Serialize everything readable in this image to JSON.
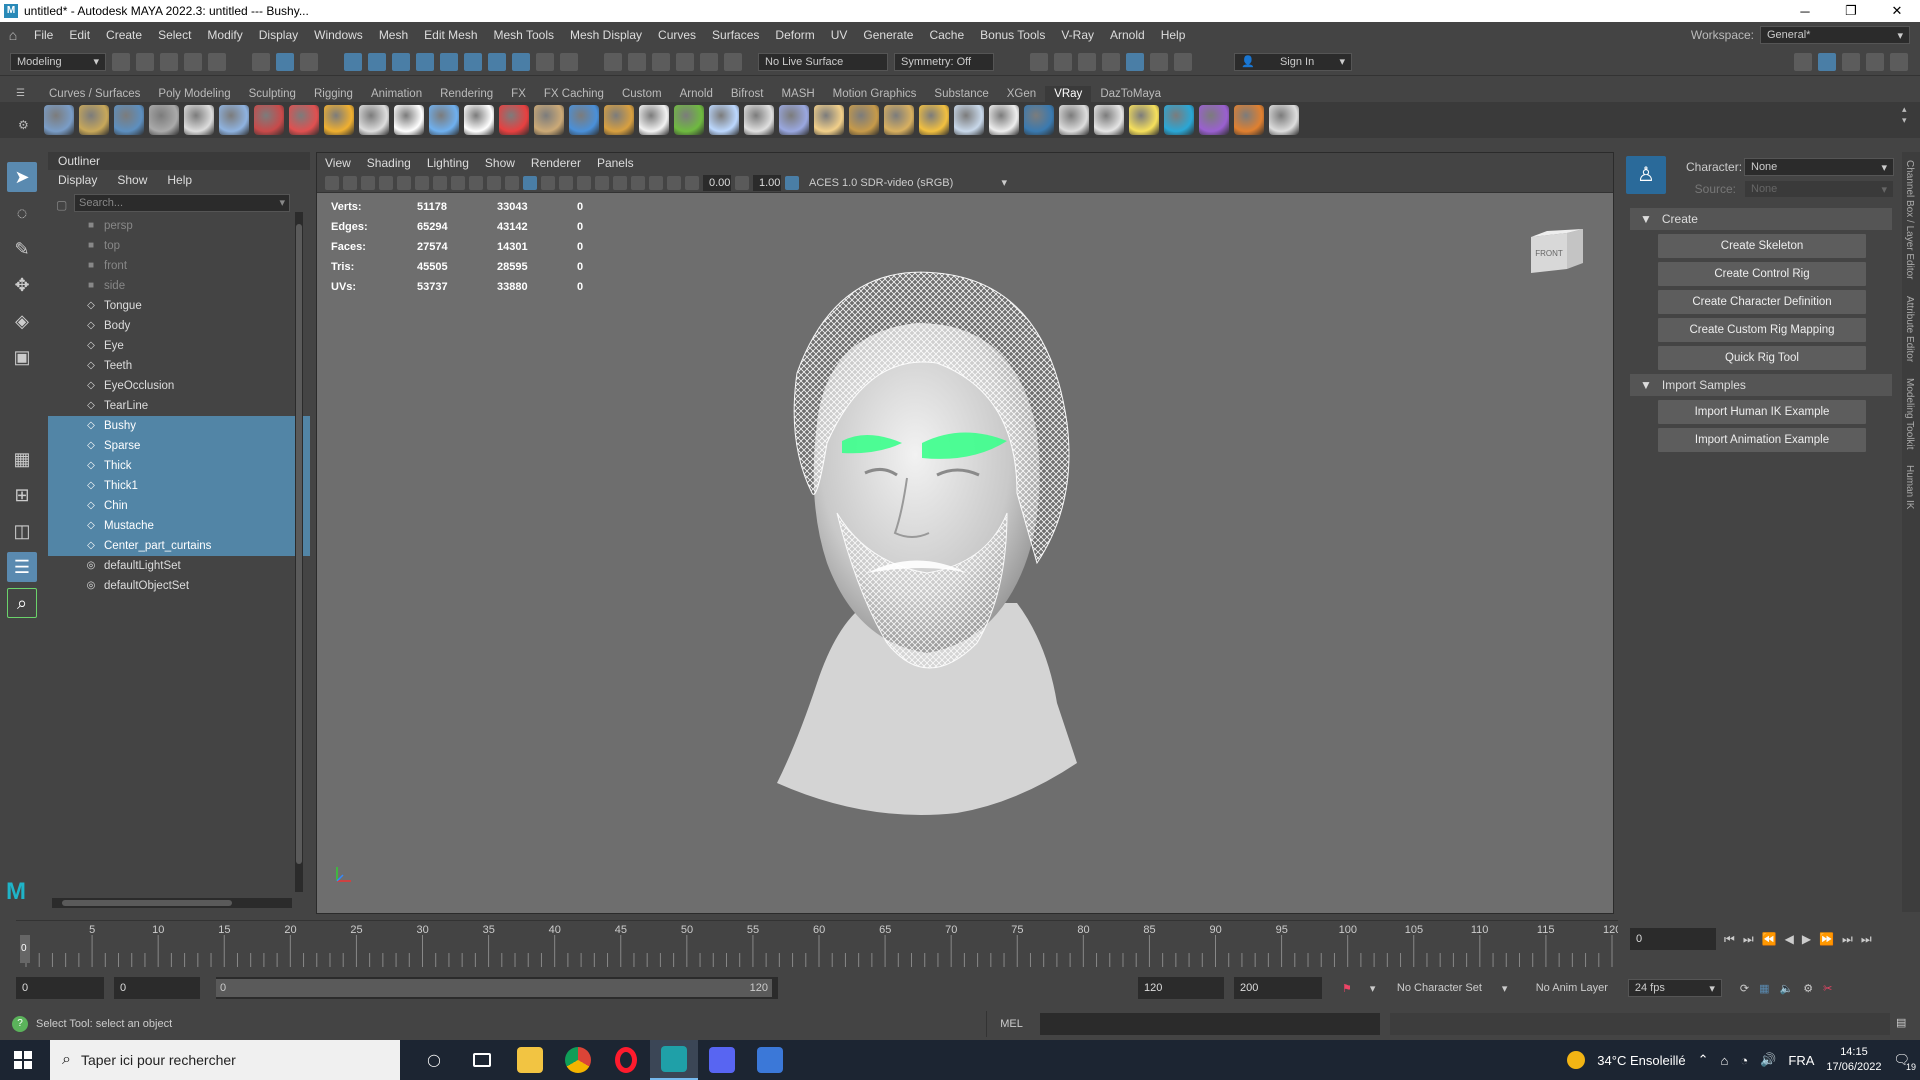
{
  "window": {
    "title": "untitled* - Autodesk MAYA 2022.3: untitled  ---  Bushy...",
    "minimize": "─",
    "maximize": "❐",
    "close": "✕"
  },
  "menubar": {
    "items": [
      "File",
      "Edit",
      "Create",
      "Select",
      "Modify",
      "Display",
      "Windows",
      "Mesh",
      "Edit Mesh",
      "Mesh Tools",
      "Mesh Display",
      "Curves",
      "Surfaces",
      "Deform",
      "UV",
      "Generate",
      "Cache",
      "Bonus Tools",
      "V-Ray",
      "Arnold",
      "Help"
    ],
    "workspace_label": "Workspace:",
    "workspace_value": "General*"
  },
  "statusline": {
    "mode": "Modeling",
    "live_surface": "No Live Surface",
    "symmetry": "Symmetry: Off",
    "sign_in": "Sign In"
  },
  "shelf": {
    "tabs": [
      "Curves / Surfaces",
      "Poly Modeling",
      "Sculpting",
      "Rigging",
      "Animation",
      "Rendering",
      "FX",
      "FX Caching",
      "Custom",
      "Arnold",
      "Bifrost",
      "MASH",
      "Motion Graphics",
      "Substance",
      "XGen",
      "VRay",
      "DazToMaya"
    ],
    "active_tab": "VRay",
    "icon_colors": [
      "#7a9dc7",
      "#c8a85a",
      "#5d8fbf",
      "#aaaaaa",
      "#dddddd",
      "#8fb3e0",
      "#c84a4a",
      "#e05050",
      "#f0b030",
      "#dddddd",
      "#ffffff",
      "#6fb0ef",
      "#ffffff",
      "#e84040",
      "#ccaa77",
      "#4a90d9",
      "#d8a040",
      "#f2f2f2",
      "#6fba40",
      "#bcd8ff",
      "#e0e0e0",
      "#9aa8e0",
      "#f2d08a",
      "#c69a4a",
      "#d8b060",
      "#f2c040",
      "#c8d8ea",
      "#eeeeee",
      "#3a7ab0",
      "#dddddd",
      "#e5e5e5",
      "#f6e05c",
      "#2aa7d6",
      "#9a60d0",
      "#e08030",
      "#dddddd"
    ]
  },
  "toolbox": {
    "tools": [
      "select-tool",
      "lasso-tool",
      "paint-select-tool",
      "move-tool",
      "rotate-tool",
      "scale-tool"
    ]
  },
  "outliner": {
    "title": "Outliner",
    "menu": [
      "Display",
      "Show",
      "Help"
    ],
    "search_placeholder": "Search...",
    "items": [
      {
        "label": "persp",
        "kind": "camera",
        "selected": false
      },
      {
        "label": "top",
        "kind": "camera",
        "selected": false
      },
      {
        "label": "front",
        "kind": "camera",
        "selected": false
      },
      {
        "label": "side",
        "kind": "camera",
        "selected": false
      },
      {
        "label": "Tongue",
        "kind": "mesh",
        "selected": false
      },
      {
        "label": "Body",
        "kind": "mesh",
        "selected": false
      },
      {
        "label": "Eye",
        "kind": "mesh",
        "selected": false
      },
      {
        "label": "Teeth",
        "kind": "mesh",
        "selected": false
      },
      {
        "label": "EyeOcclusion",
        "kind": "mesh",
        "selected": false
      },
      {
        "label": "TearLine",
        "kind": "mesh",
        "selected": false
      },
      {
        "label": "Bushy",
        "kind": "mesh",
        "selected": true
      },
      {
        "label": "Sparse",
        "kind": "mesh",
        "selected": true
      },
      {
        "label": "Thick",
        "kind": "mesh",
        "selected": true
      },
      {
        "label": "Thick1",
        "kind": "mesh",
        "selected": true
      },
      {
        "label": "Chin",
        "kind": "mesh",
        "selected": true
      },
      {
        "label": "Mustache",
        "kind": "mesh",
        "selected": true
      },
      {
        "label": "Center_part_curtains",
        "kind": "mesh",
        "selected": true
      },
      {
        "label": "defaultLightSet",
        "kind": "set",
        "selected": false
      },
      {
        "label": "defaultObjectSet",
        "kind": "set",
        "selected": false
      }
    ]
  },
  "viewport": {
    "menu": [
      "View",
      "Shading",
      "Lighting",
      "Show",
      "Renderer",
      "Panels"
    ],
    "exposure": "0.00",
    "gamma": "1.00",
    "color_space": "ACES 1.0 SDR-video (sRGB)",
    "hud": [
      {
        "label": "Verts:",
        "a": "51178",
        "b": "33043",
        "c": "0"
      },
      {
        "label": "Edges:",
        "a": "65294",
        "b": "43142",
        "c": "0"
      },
      {
        "label": "Faces:",
        "a": "27574",
        "b": "14301",
        "c": "0"
      },
      {
        "label": "Tris:",
        "a": "45505",
        "b": "28595",
        "c": "0"
      },
      {
        "label": "UVs:",
        "a": "53737",
        "b": "33880",
        "c": "0"
      }
    ],
    "viewcube_label": "FRONT"
  },
  "humanik": {
    "character_label": "Character:",
    "character_value": "None",
    "source_label": "Source:",
    "source_value": "None",
    "section_create": "Create",
    "create_buttons": [
      "Create Skeleton",
      "Create Control Rig",
      "Create Character Definition",
      "Create Custom Rig Mapping",
      "Quick Rig Tool"
    ],
    "section_import": "Import Samples",
    "import_buttons": [
      "Import Human IK Example",
      "Import Animation Example"
    ]
  },
  "side_tabs": [
    "Channel Box / Layer Editor",
    "Attribute Editor",
    "Modeling Toolkit",
    "Human IK"
  ],
  "timeline": {
    "ticks": [
      "5",
      "10",
      "15",
      "20",
      "25",
      "30",
      "35",
      "40",
      "45",
      "50",
      "55",
      "60",
      "65",
      "70",
      "75",
      "80",
      "85",
      "90",
      "95",
      "100",
      "105",
      "110",
      "115",
      "120"
    ],
    "current_frame": "0",
    "current_marker": "0",
    "range_start": "0",
    "anim_start": "0",
    "slider_start": "0",
    "slider_end": "120",
    "anim_end": "120",
    "range_end": "200",
    "character_set": "No Character Set",
    "anim_layer": "No Anim Layer",
    "fps": "24 fps"
  },
  "helpline": {
    "message": "Select Tool: select an object",
    "mel": "MEL"
  },
  "taskbar": {
    "search_placeholder": "Taper ici pour rechercher",
    "weather": "34°C  Ensoleillé",
    "lang": "FRA",
    "time": "14:15",
    "date": "17/06/2022",
    "notifications": "19",
    "apps": [
      {
        "name": "task-view",
        "color": "#1c2532"
      },
      {
        "name": "file-explorer",
        "color": "#f2c442"
      },
      {
        "name": "chrome",
        "color": "#db4437"
      },
      {
        "name": "opera",
        "color": "#ff1b2d"
      },
      {
        "name": "maya",
        "color": "#1fa0a8"
      },
      {
        "name": "discord",
        "color": "#5865f2"
      },
      {
        "name": "photos",
        "color": "#3b78d8"
      }
    ]
  },
  "colors": {
    "selection": "#5285a6",
    "accent": "#5a8ab0",
    "eyebrow": "#3cff8c"
  }
}
